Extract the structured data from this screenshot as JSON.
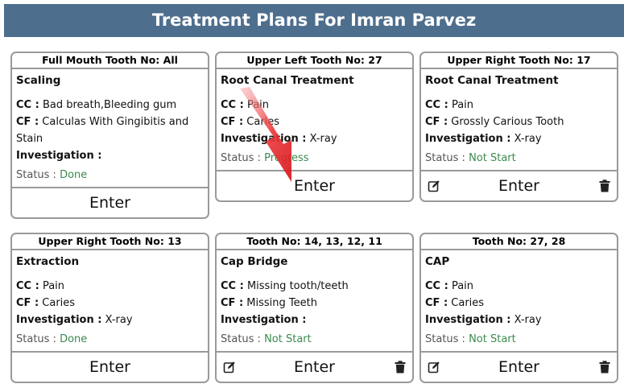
{
  "header": {
    "title": "Treatment Plans For Imran Parvez"
  },
  "labels": {
    "cc": "CC :",
    "cf": "CF :",
    "investigation": "Investigation :",
    "status": "Status :",
    "enter": "Enter"
  },
  "cards": [
    {
      "title": "Full Mouth Tooth No: All",
      "treatment": "Scaling",
      "cc": "Bad breath,Bleeding gum",
      "cf": "Calculas With Gingibitis and Stain",
      "investigation": "",
      "status": "Done"
    },
    {
      "title": "Upper Left Tooth No: 27",
      "treatment": "Root Canal Treatment",
      "cc": "Pain",
      "cf": "Caries",
      "investigation": "X-ray",
      "status": "Progress"
    },
    {
      "title": "Upper Right Tooth No: 17",
      "treatment": "Root Canal Treatment",
      "cc": "Pain",
      "cf": "Grossly Carious Tooth",
      "investigation": "X-ray",
      "status": "Not Start"
    },
    {
      "title": "Upper Right Tooth No: 13",
      "treatment": "Extraction",
      "cc": "Pain",
      "cf": "Caries",
      "investigation": "X-ray",
      "status": "Done"
    },
    {
      "title": "Tooth No: 14, 13, 12, 11",
      "treatment": "Cap Bridge",
      "cc": "Missing tooth/teeth",
      "cf": "Missing Teeth",
      "investigation": "",
      "status": "Not Start"
    },
    {
      "title": "Tooth No: 27, 28",
      "treatment": "CAP",
      "cc": "Pain",
      "cf": "Caries",
      "investigation": "X-ray",
      "status": "Not Start"
    }
  ],
  "icons": {
    "edit": "edit-icon",
    "trash": "trash-icon",
    "annotation": "red-arrow"
  },
  "colors": {
    "header_bg": "#4e6e8e",
    "status_value": "#3c8a4e",
    "arrow": "#e8262b"
  }
}
